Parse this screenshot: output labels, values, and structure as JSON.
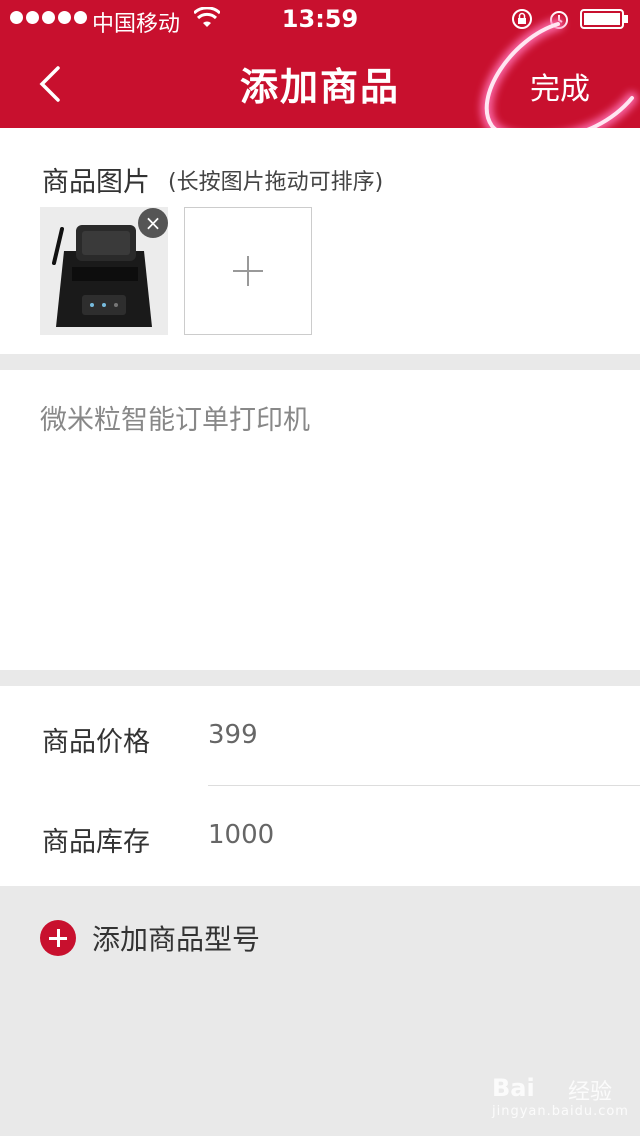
{
  "status_bar": {
    "carrier": "中国移动",
    "time": "13:59"
  },
  "nav": {
    "title": "添加商品",
    "done_label": "完成",
    "accent_color": "#c8102e"
  },
  "images": {
    "label": "商品图片",
    "hint": "(长按图片拖动可排序)",
    "remove_glyph": "×",
    "items": [
      {
        "icon": "receipt-printer-photo"
      }
    ]
  },
  "description": {
    "text": "微米粒智能订单打印机"
  },
  "fields": {
    "price_label": "商品价格",
    "price_value": "399",
    "stock_label": "商品库存",
    "stock_value": "1000"
  },
  "variant": {
    "label": "添加商品型号"
  },
  "watermark": {
    "logo": "Bai",
    "text": "经验",
    "sub": "jingyan.baidu.com"
  }
}
